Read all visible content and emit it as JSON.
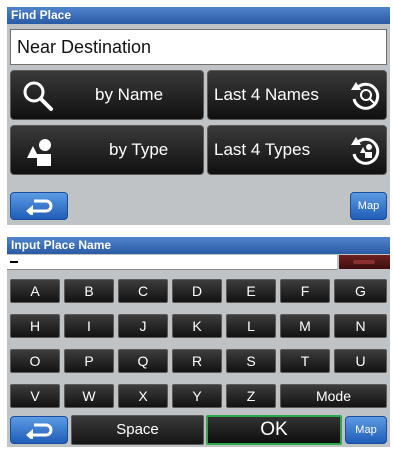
{
  "find_place": {
    "title": "Find Place",
    "search_value": "Near Destination",
    "buttons": {
      "by_name": "by Name",
      "last_names": "Last 4 Names",
      "by_type": "by Type",
      "last_types": "Last 4 Types"
    },
    "map_label": "Map"
  },
  "input_screen": {
    "title": "Input Place Name",
    "input_value": "",
    "keyboard_rows": [
      [
        "A",
        "B",
        "C",
        "D",
        "E",
        "F",
        "G"
      ],
      [
        "H",
        "I",
        "J",
        "K",
        "L",
        "M",
        "N"
      ],
      [
        "O",
        "P",
        "Q",
        "R",
        "S",
        "T",
        "U"
      ],
      [
        "V",
        "W",
        "X",
        "Y",
        "Z"
      ]
    ],
    "mode_label": "Mode",
    "space_label": "Space",
    "ok_label": "OK",
    "map_label": "Map"
  },
  "colors": {
    "title_bar": "#2a5aa4",
    "nav_button": "#1f5db8",
    "ok_border": "#2ea84a",
    "panel_background": "#bfc3c6"
  }
}
